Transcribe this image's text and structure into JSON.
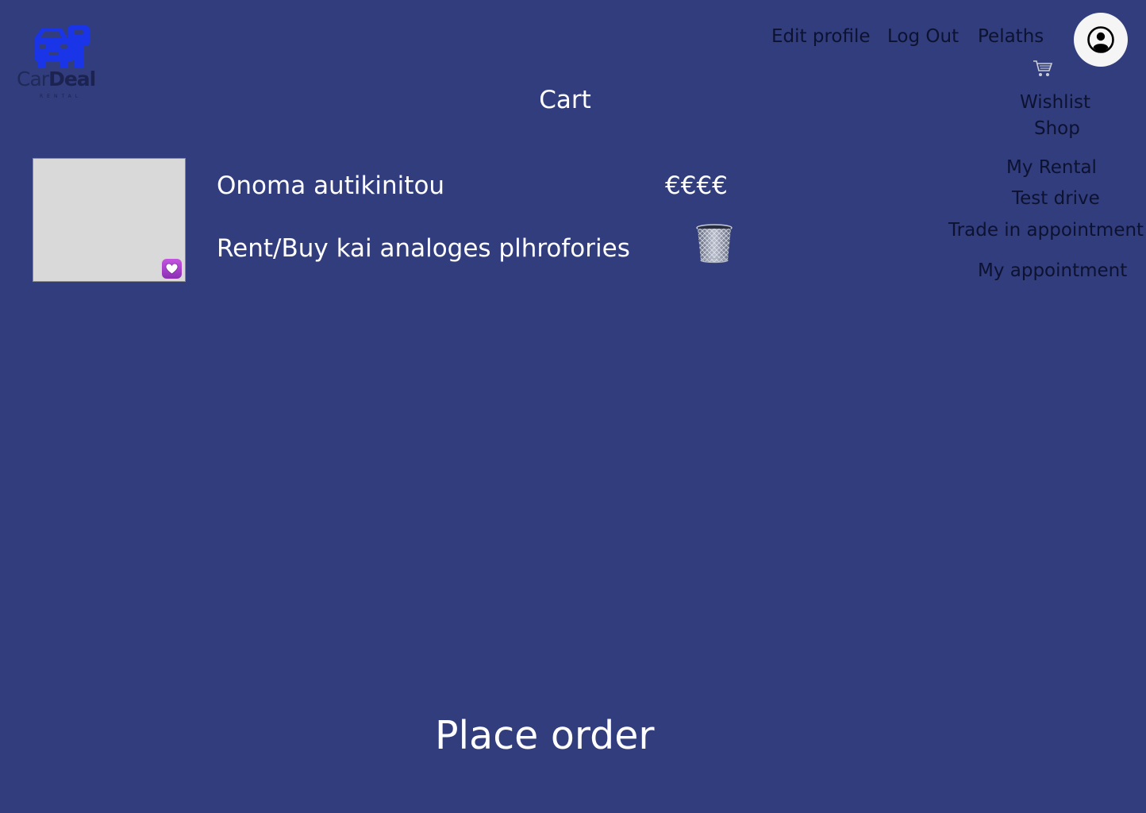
{
  "brand": {
    "word1": "Car",
    "word2": "Deal",
    "tagline": "RENTAL"
  },
  "nav": {
    "edit_profile": "Edit profile",
    "log_out": "Log Out",
    "pelaths": "Pelaths"
  },
  "menu": {
    "wishlist": "Wishlist",
    "shop": "Shop",
    "my_rental": "My Rental",
    "test_drive": "Test drive",
    "trade_in": "Trade in appointment",
    "my_appointment": "My appointment"
  },
  "page": {
    "title": "Cart"
  },
  "cart_item": {
    "name": "Onoma autikinitou",
    "description": "Rent/Buy kai analoges plhrofories",
    "price": "€€€€"
  },
  "actions": {
    "place_order": "Place order"
  },
  "colors": {
    "background": "#313d7d",
    "logo_blue": "#1a35e8",
    "menu_text": "#0d1230",
    "heart_badge": "#a23fce"
  },
  "icons": {
    "logo": "car-key-icon",
    "avatar": "user-circle-icon",
    "cart": "shopping-cart-icon",
    "wishlist_badge": "heart-icon",
    "remove": "trash-icon"
  }
}
